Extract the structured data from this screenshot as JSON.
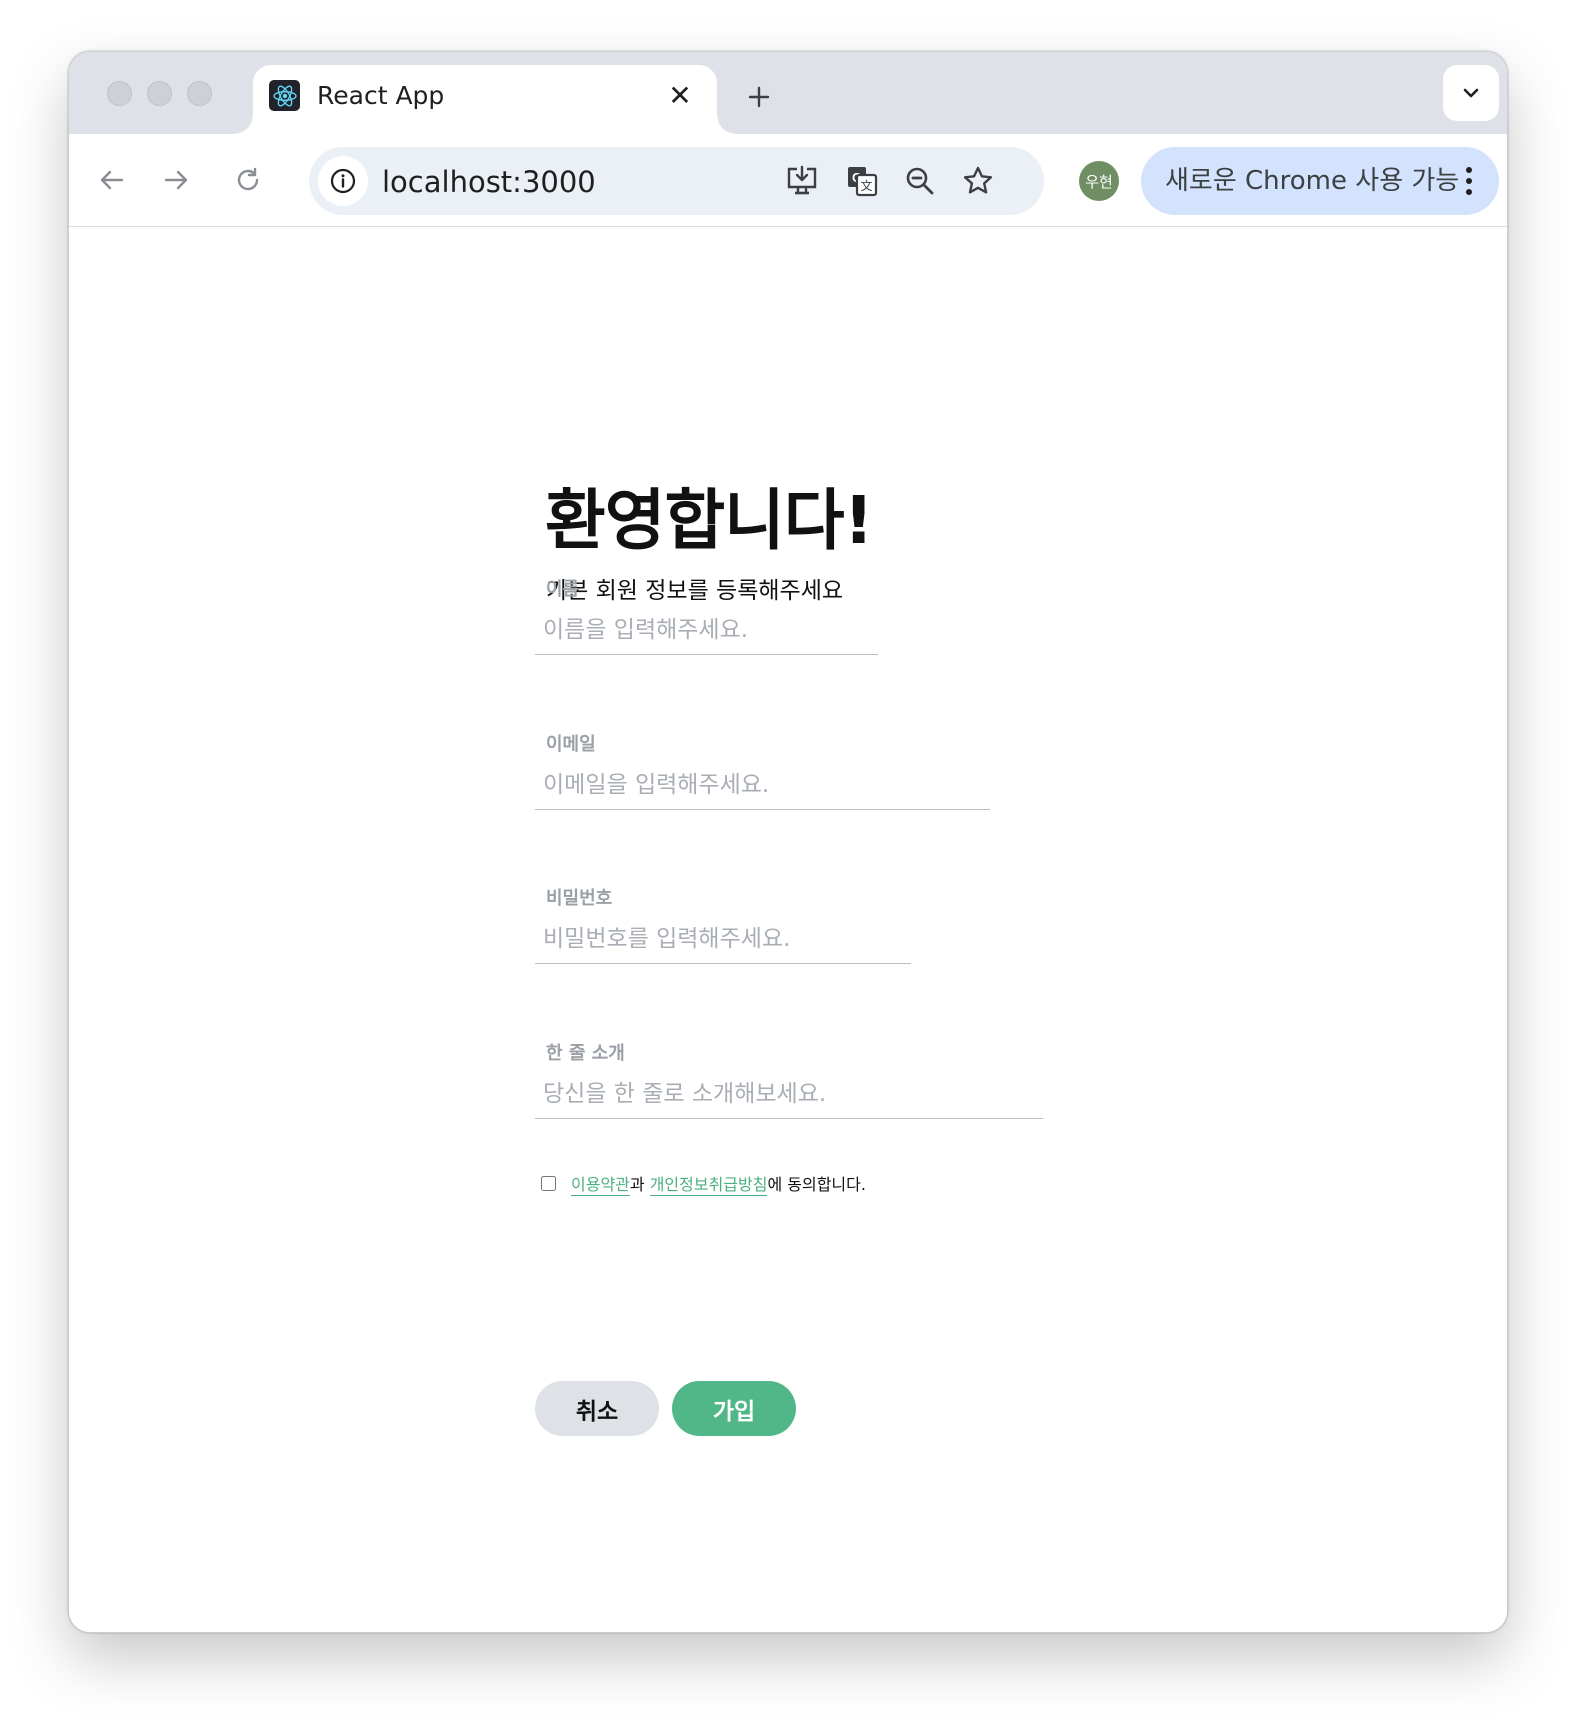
{
  "browser": {
    "tab_title": "React App",
    "url": "localhost:3000",
    "profile_initials": "우현",
    "update_label": "새로운 Chrome 사용 가능"
  },
  "page": {
    "heading": "환영합니다!",
    "subheading": "기본 회원 정보를 등록해주세요",
    "fields": [
      {
        "label": "이름",
        "placeholder": "이름을 입력해주세요.",
        "value": ""
      },
      {
        "label": "이메일",
        "placeholder": "이메일을 입력해주세요.",
        "value": ""
      },
      {
        "label": "비밀번호",
        "placeholder": "비밀번호를 입력해주세요.",
        "value": ""
      },
      {
        "label": "한 줄 소개",
        "placeholder": "당신을 한 줄로 소개해보세요.",
        "value": ""
      }
    ],
    "agreement": {
      "terms_link": "이용약관",
      "conjunction": "과 ",
      "privacy_link": "개인정보취급방침",
      "suffix": "에 동의합니다.",
      "checked": false
    },
    "buttons": {
      "cancel": "취소",
      "join": "가입"
    }
  },
  "colors": {
    "accent": "#52b788",
    "link": "#4caf82",
    "label": "#9aa0a6"
  }
}
